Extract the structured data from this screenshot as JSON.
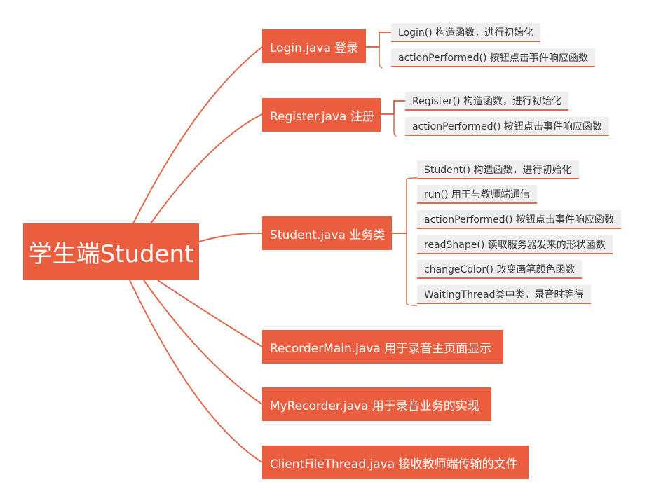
{
  "root": {
    "label": "学生端Student"
  },
  "branches": [
    {
      "label": "Login.java 登录",
      "children": [
        "Login() 构造函数，进行初始化",
        "actionPerformed() 按钮点击事件响应函数"
      ]
    },
    {
      "label": "Register.java 注册",
      "children": [
        "Register() 构造函数，进行初始化",
        "actionPerformed() 按钮点击事件响应函数"
      ]
    },
    {
      "label": "Student.java 业务类",
      "children": [
        "Student() 构造函数，进行初始化",
        "run() 用于与教师端通信",
        "actionPerformed() 按钮点击事件响应函数",
        "readShape() 读取服务器发来的形状函数",
        "changeColor() 改变画笔颜色函数",
        "WaitingThread类中类，录音时等待"
      ]
    },
    {
      "label": "RecorderMain.java 用于录音主页面显示",
      "children": []
    },
    {
      "label": "MyRecorder.java 用于录音业务的实现",
      "children": []
    },
    {
      "label": "ClientFileThread.java 接收教师端传输的文件",
      "children": []
    }
  ],
  "colors": {
    "node": "#EA5D3E",
    "line": "#E06A4C",
    "leaf_bg": "#EFEFEF"
  }
}
